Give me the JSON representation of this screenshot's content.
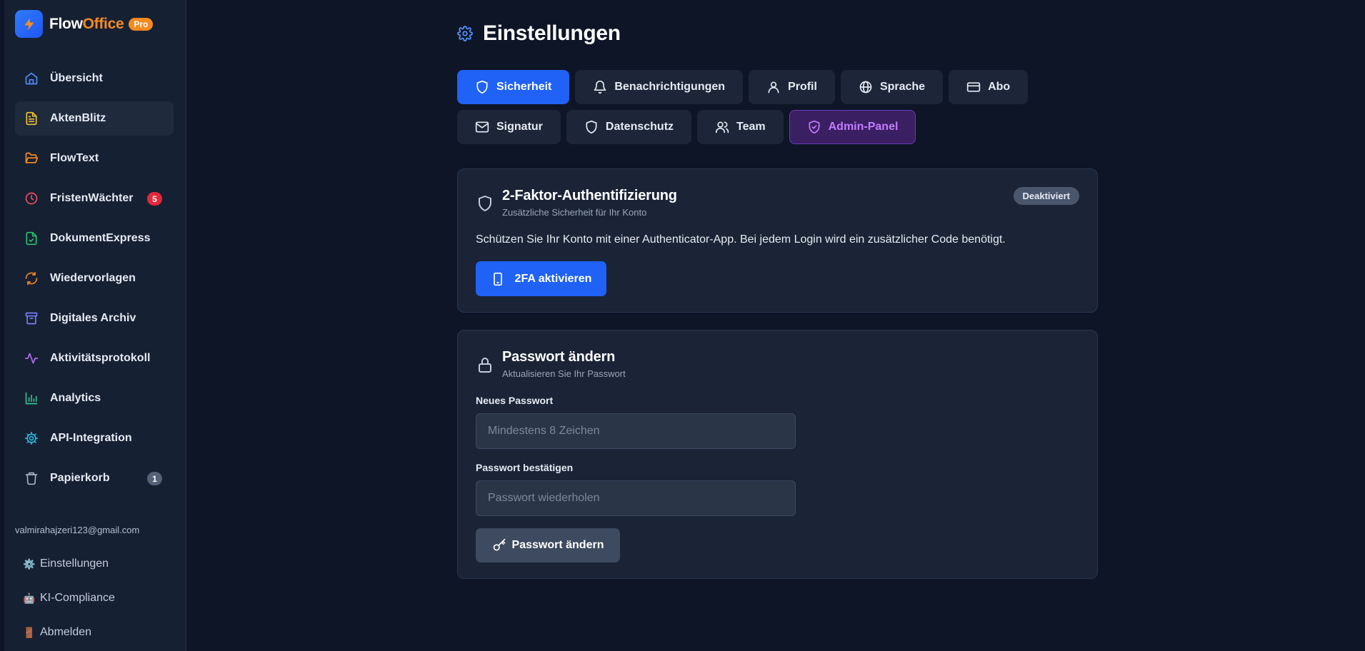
{
  "app": {
    "name_part1": "Flow",
    "name_part2": "Office",
    "badge": "Pro"
  },
  "colors": {
    "accent": "#1f62f5",
    "brand_orange": "#f58a1f",
    "admin_purple": "#c37cff",
    "badge_red": "#e3283c"
  },
  "sidebar": {
    "items": [
      {
        "label": "Übersicht",
        "icon": "home-icon"
      },
      {
        "label": "AktenBlitz",
        "icon": "file-text-icon",
        "active": true
      },
      {
        "label": "FlowText",
        "icon": "folder-open-icon"
      },
      {
        "label": "FristenWächter",
        "icon": "clock-icon",
        "badge": "5"
      },
      {
        "label": "DokumentExpress",
        "icon": "file-check-icon"
      },
      {
        "label": "Wiedervorlagen",
        "icon": "refresh-icon"
      },
      {
        "label": "Digitales Archiv",
        "icon": "archive-icon"
      },
      {
        "label": "Aktivitätsprotokoll",
        "icon": "activity-icon"
      },
      {
        "label": "Analytics",
        "icon": "bar-chart-icon"
      },
      {
        "label": "API-Integration",
        "icon": "gear-icon"
      },
      {
        "label": "Papierkorb",
        "icon": "trash-icon",
        "badge": "1"
      }
    ],
    "user_email": "valmirahajzeri123@gmail.com",
    "bottom": [
      {
        "label": "Einstellungen",
        "icon": "⚙️"
      },
      {
        "label": "KI-Compliance",
        "icon": "🤖"
      },
      {
        "label": "Abmelden",
        "icon": "🚪"
      }
    ]
  },
  "page": {
    "title": "Einstellungen"
  },
  "tabs": {
    "row1": [
      {
        "label": "Sicherheit",
        "icon": "shield-icon",
        "active": true
      },
      {
        "label": "Benachrichtigungen",
        "icon": "bell-icon"
      },
      {
        "label": "Profil",
        "icon": "user-icon"
      },
      {
        "label": "Sprache",
        "icon": "globe-icon"
      },
      {
        "label": "Abo",
        "icon": "credit-card-icon"
      }
    ],
    "row2": [
      {
        "label": "Signatur",
        "icon": "mail-icon"
      },
      {
        "label": "Datenschutz",
        "icon": "shield-icon"
      },
      {
        "label": "Team",
        "icon": "users-icon"
      },
      {
        "label": "Admin-Panel",
        "icon": "shield-check-icon"
      }
    ]
  },
  "twofa": {
    "title": "2-Faktor-Authentifizierung",
    "subtitle": "Zusätzliche Sicherheit für Ihr Konto",
    "status": "Deaktiviert",
    "description": "Schützen Sie Ihr Konto mit einer Authenticator-App. Bei jedem Login wird ein zusätzlicher Code benötigt.",
    "button": "2FA aktivieren"
  },
  "password": {
    "title": "Passwort ändern",
    "subtitle": "Aktualisieren Sie Ihr Passwort",
    "new_label": "Neues Passwort",
    "new_placeholder": "Mindestens 8 Zeichen",
    "new_value": "",
    "confirm_label": "Passwort bestätigen",
    "confirm_placeholder": "Passwort wiederholen",
    "confirm_value": "",
    "button": "Passwort ändern"
  }
}
